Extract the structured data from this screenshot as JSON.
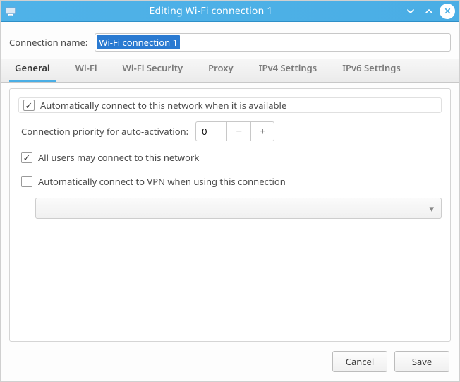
{
  "window": {
    "title": "Editing Wi-Fi connection 1"
  },
  "form": {
    "connection_name_label": "Connection name:",
    "connection_name_value": "Wi-Fi connection 1"
  },
  "tabs": [
    {
      "label": "General",
      "active": true
    },
    {
      "label": "Wi-Fi",
      "active": false
    },
    {
      "label": "Wi-Fi Security",
      "active": false
    },
    {
      "label": "Proxy",
      "active": false
    },
    {
      "label": "IPv4 Settings",
      "active": false
    },
    {
      "label": "IPv6 Settings",
      "active": false
    }
  ],
  "general": {
    "auto_connect_label": "Automatically connect to this network when it is available",
    "auto_connect_checked": true,
    "priority_label": "Connection priority for auto-activation:",
    "priority_value": "0",
    "all_users_label": "All users may connect to this network",
    "all_users_checked": true,
    "auto_vpn_label": "Automatically connect to VPN when using this connection",
    "auto_vpn_checked": false,
    "vpn_selected": ""
  },
  "buttons": {
    "cancel": "Cancel",
    "save": "Save"
  },
  "icons": {
    "minus": "−",
    "plus": "+",
    "caret_down": "▾"
  }
}
